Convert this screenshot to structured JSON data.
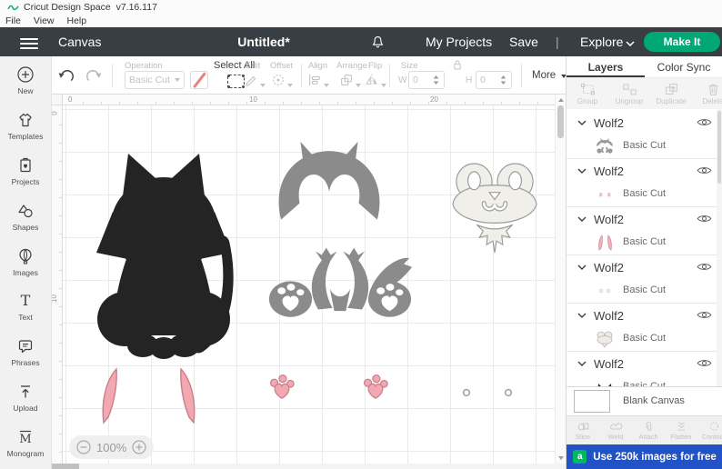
{
  "titlebar": {
    "app_name": "Cricut Design Space",
    "version": "v7.16.117",
    "menus": [
      "File",
      "View",
      "Help"
    ]
  },
  "navbar": {
    "canvas": "Canvas",
    "title": "Untitled*",
    "my_projects": "My Projects",
    "save": "Save",
    "divider": "|",
    "explore": "Explore",
    "make_it": "Make It"
  },
  "toolbar": {
    "operation": {
      "label": "Operation",
      "value": "Basic Cut"
    },
    "select_all": "Select All",
    "edit": "Edit",
    "offset": "Offset",
    "align": "Align",
    "arrange": "Arrange",
    "flip": "Flip",
    "size": {
      "label": "Size",
      "w_label": "W",
      "w_value": "0",
      "h_label": "H",
      "h_value": "0"
    },
    "more": "More"
  },
  "sidebar": {
    "items": [
      {
        "label": "New"
      },
      {
        "label": "Templates"
      },
      {
        "label": "Projects"
      },
      {
        "label": "Shapes"
      },
      {
        "label": "Images"
      },
      {
        "label": "Text"
      },
      {
        "label": "Phrases"
      },
      {
        "label": "Upload"
      },
      {
        "label": "Monogram"
      }
    ]
  },
  "canvas": {
    "h_ruler": [
      "0",
      "10",
      "20"
    ],
    "v_ruler": [
      "0",
      "10"
    ],
    "zoom_level": "100%"
  },
  "layers_panel": {
    "tabs": [
      {
        "label": "Layers"
      },
      {
        "label": "Color Sync"
      }
    ],
    "actions": [
      {
        "label": "Group"
      },
      {
        "label": "Ungroup"
      },
      {
        "label": "Duplicate"
      },
      {
        "label": "Delete"
      }
    ],
    "groups": [
      {
        "name": "Wolf2",
        "layer": "Basic Cut",
        "thumb": "gray-wolf-parts"
      },
      {
        "name": "Wolf2",
        "layer": "Basic Cut",
        "thumb": "pink-paw-dots"
      },
      {
        "name": "Wolf2",
        "layer": "Basic Cut",
        "thumb": "pink-ears"
      },
      {
        "name": "Wolf2",
        "layer": "Basic Cut",
        "thumb": "small-circles"
      },
      {
        "name": "Wolf2",
        "layer": "Basic Cut",
        "thumb": "cream-face"
      },
      {
        "name": "Wolf2",
        "layer": "Basic Cut",
        "thumb": "black-wolf"
      }
    ],
    "blank_canvas": "Blank Canvas",
    "bottom_actions": [
      {
        "label": "Slice"
      },
      {
        "label": "Weld"
      },
      {
        "label": "Attach"
      },
      {
        "label": "Flatten"
      },
      {
        "label": "Contour"
      }
    ],
    "promo": {
      "icon_letter": "a",
      "text": "Use 250k images for free"
    }
  },
  "colors": {
    "accent_green": "#00a878",
    "promo_blue": "#2152c6",
    "shape_pink": "#f3a8b1",
    "shape_gray": "#8b8b8b",
    "shape_black": "#242424",
    "shape_cream": "#f1efe9"
  }
}
